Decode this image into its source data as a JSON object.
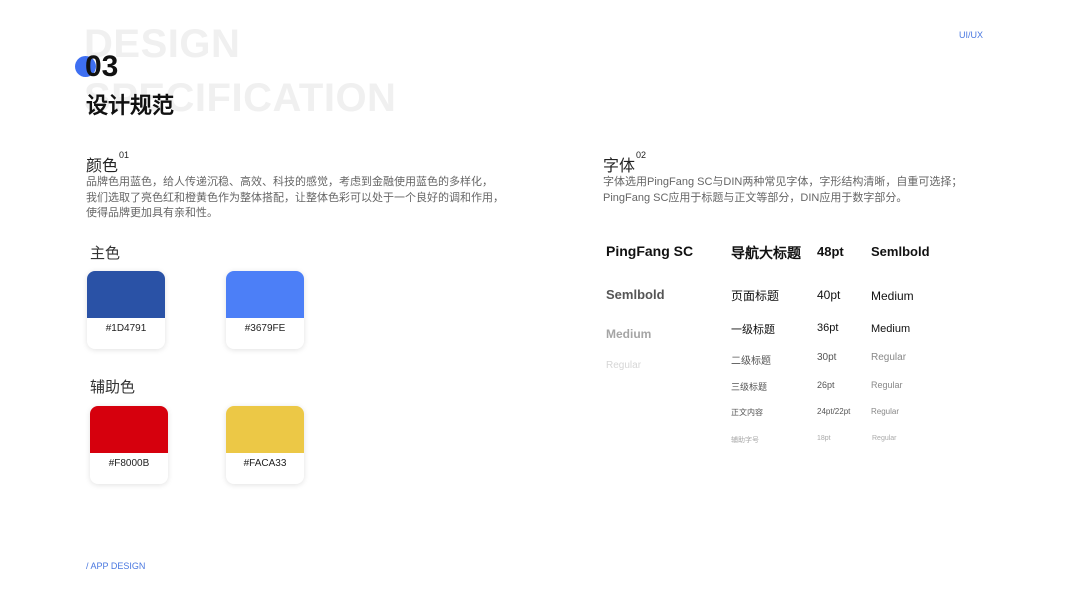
{
  "header": {
    "bg_word_1": "DESIGN",
    "bg_word_2": "SPECIFICATION",
    "number": "03",
    "title_cn": "设计规范",
    "corner_tag": "UI/UX"
  },
  "footer": {
    "label": "/ APP DESIGN"
  },
  "colors_section": {
    "title": "颜色",
    "title_sup": "01",
    "desc_line1": "品牌色用蓝色，给人传递沉稳、高效、科技的感觉，考虑到金融使用蓝色的多样化，",
    "desc_line2": "我们选取了亮色红和橙黄色作为整体搭配，让整体色彩可以处于一个良好的调和作用，",
    "desc_line3": "使得品牌更加具有亲和性。",
    "primary_label": "主色",
    "secondary_label": "辅助色",
    "primary": [
      {
        "hex": "#1D4791",
        "swatch": "#2a52a6"
      },
      {
        "hex": "#3679FE",
        "swatch": "#4c7ff7"
      }
    ],
    "secondary": [
      {
        "hex": "#F8000B",
        "swatch": "#d6000d"
      },
      {
        "hex": "#FACA33",
        "swatch": "#ecc846"
      }
    ]
  },
  "fonts_section": {
    "title": "字体",
    "title_sup": "02",
    "desc_line1": "字体选用PingFang SC与DIN两种常见字体，字形结构清晰，自重可选择；",
    "desc_line2": "PingFang SC应用于标题与正文等部分，DIN应用于数字部分。",
    "family_name": "PingFang SC",
    "weights": [
      "Semlbold",
      "Medium",
      "Regular"
    ],
    "rows": [
      {
        "name": "导航大标题",
        "size": "48pt",
        "weight": "Semlbold"
      },
      {
        "name": "页面标题",
        "size": "40pt",
        "weight": "Medium"
      },
      {
        "name": "一级标题",
        "size": "36pt",
        "weight": "Medium"
      },
      {
        "name": "二级标题",
        "size": "30pt",
        "weight": "Regular"
      },
      {
        "name": "三级标题",
        "size": "26pt",
        "weight": "Regular"
      },
      {
        "name": "正文内容",
        "size": "24pt/22pt",
        "weight": "Regular"
      },
      {
        "name": "辅助字号",
        "size": "18pt",
        "weight": "Regular"
      }
    ]
  },
  "colors": {
    "accent": "#3e6ff2",
    "link": "#4a78e0"
  }
}
